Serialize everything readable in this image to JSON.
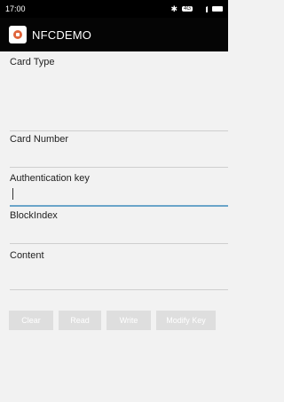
{
  "status": {
    "time": "17:00"
  },
  "app": {
    "title": "NFCDEMO"
  },
  "fields": {
    "card_type_label": "Card Type",
    "card_number_label": "Card Number",
    "auth_key_label": "Authentication key",
    "block_index_label": "BlockIndex",
    "content_label": "Content"
  },
  "buttons": {
    "clear": "Clear",
    "read": "Read",
    "write": "Write",
    "modify_key": "Modify Key"
  }
}
